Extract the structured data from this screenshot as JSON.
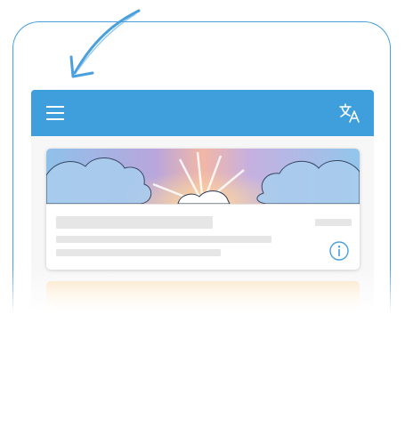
{
  "appbar": {
    "background": "#3f9fdc",
    "menu_icon": "hamburger-menu-icon",
    "translate_icon": "translate-icon"
  },
  "hint_arrow": {
    "color": "#4aa0dc",
    "icon": "pointing-arrow-icon"
  },
  "cards": [
    {
      "hero": "watercolor-sunrise-clouds",
      "info_icon": "info-circle-icon",
      "loading": true
    },
    {
      "hero": "watercolor-sunset-peach",
      "loading": true
    }
  ]
}
